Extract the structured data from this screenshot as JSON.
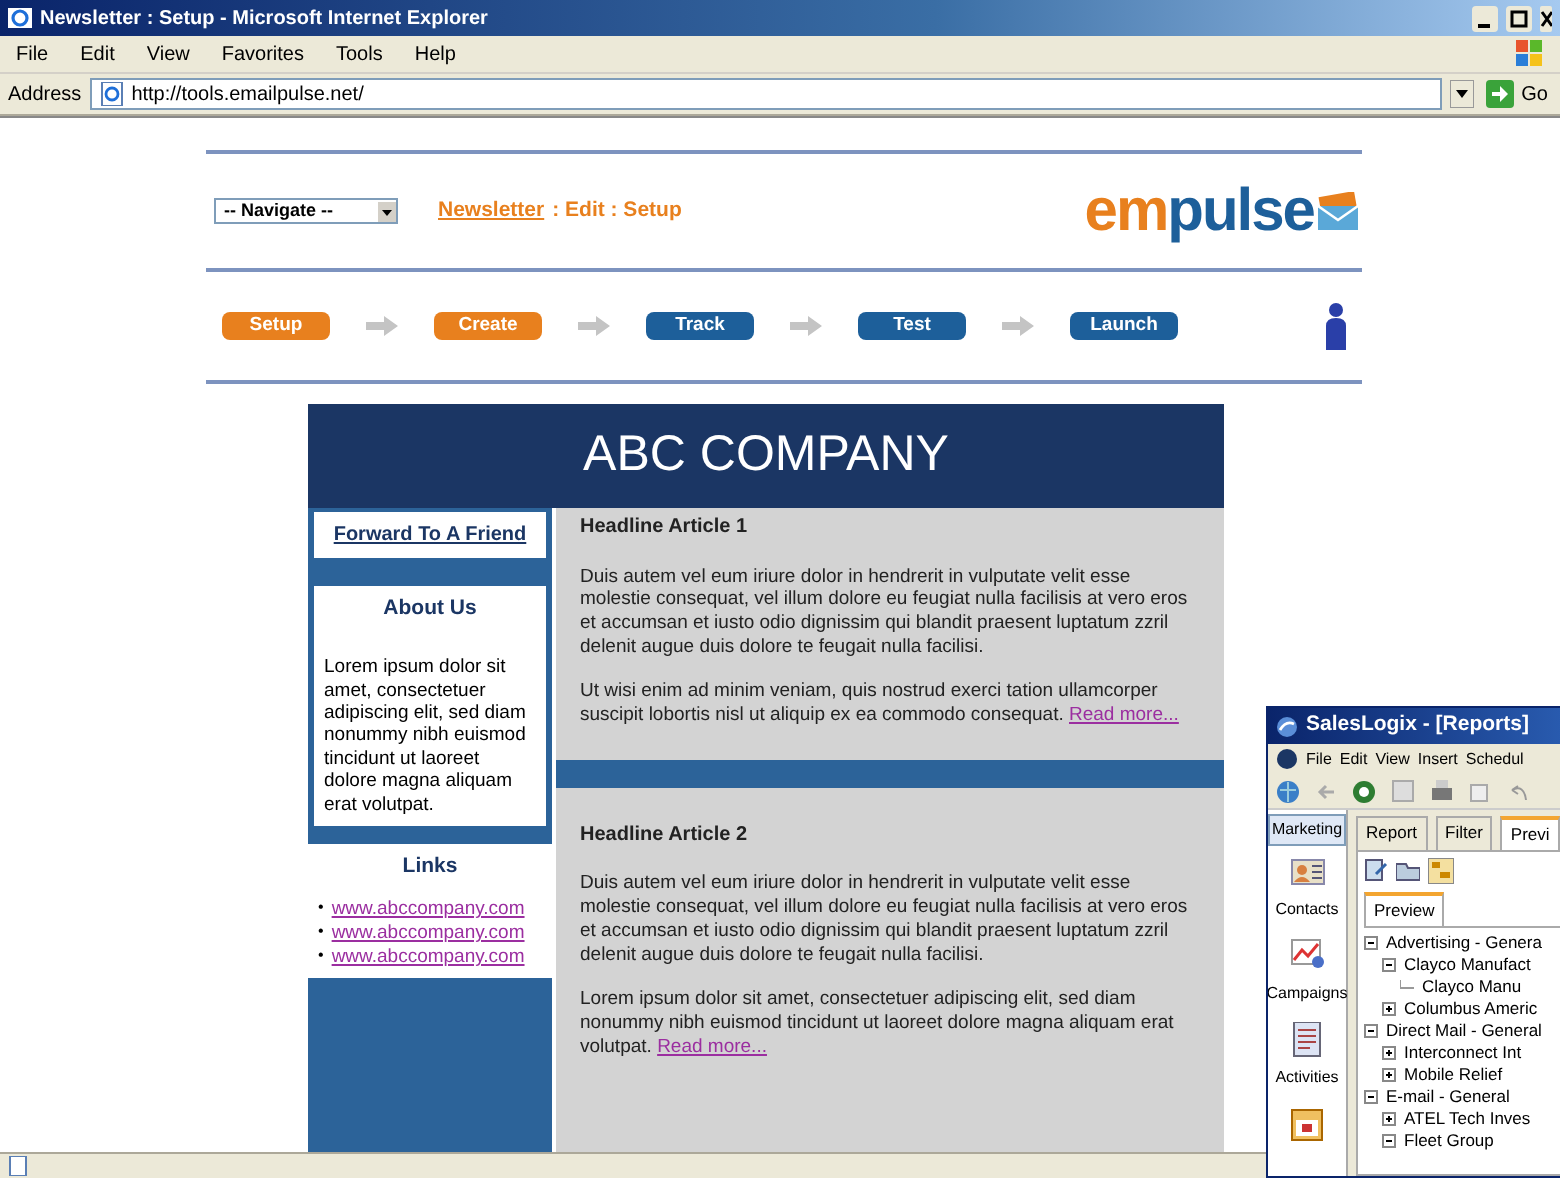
{
  "browser": {
    "title": "Newsletter : Setup - Microsoft Internet Explorer",
    "menu": [
      "File",
      "Edit",
      "View",
      "Favorites",
      "Tools",
      "Help"
    ],
    "address_label": "Address",
    "url": "http://tools.emailpulse.net/",
    "go": "Go"
  },
  "app": {
    "navigate": "-- Navigate --",
    "breadcrumb_link": "Newsletter",
    "breadcrumb_rest": ": Edit : Setup",
    "logo": [
      {
        "text": "em",
        "color": "#e8801e"
      },
      {
        "text": "pu",
        "color": "#1d5f9a"
      },
      {
        "text": "l",
        "color": "#1d5f9a"
      },
      {
        "text": "se",
        "color": "#1d5f9a"
      }
    ],
    "steps": [
      {
        "label": "Setup",
        "done": true
      },
      {
        "label": "Create",
        "done": true
      },
      {
        "label": "Track",
        "done": false
      },
      {
        "label": "Test",
        "done": false
      },
      {
        "label": "Launch",
        "done": false
      }
    ]
  },
  "newsletter": {
    "title": "ABC COMPANY",
    "forward": "Forward To A Friend",
    "about_title": "About Us",
    "about_text": "Lorem ipsum dolor sit amet, consectetuer adipiscing elit, sed diam nonummy nibh euismod tincidunt ut laoreet dolore magna aliquam erat volutpat.",
    "links_title": "Links",
    "bullet": "•",
    "links": [
      "www.abccompany.com",
      "www.abccompany.com",
      "www.abccompany.com"
    ],
    "articles": [
      {
        "headline": "Headline Article 1",
        "paragraphs": [
          "Duis autem vel eum iriure dolor in hendrerit in vulputate velit esse molestie consequat, vel illum dolore eu feugiat nulla facilisis at vero eros et accumsan et iusto odio dignissim qui blandit praesent luptatum zzril delenit augue duis dolore te feugait nulla facilisi.",
          "Ut wisi enim ad minim veniam, quis nostrud exerci tation ullamcorper suscipit lobortis nisl ut aliquip ex ea commodo consequat."
        ],
        "read_more": "Read more..."
      },
      {
        "headline": "Headline Article 2",
        "paragraphs": [
          "Duis autem vel eum iriure dolor in hendrerit in vulputate velit esse molestie consequat, vel illum dolore eu feugiat nulla facilisis at vero eros et accumsan et iusto odio dignissim qui blandit praesent luptatum zzril delenit augue duis dolore te feugait nulla facilisi.",
          "Lorem ipsum dolor sit amet, consectetuer adipiscing elit, sed diam nonummy nibh euismod tincidunt ut laoreet dolore magna aliquam erat volutpat."
        ],
        "read_more": "Read more..."
      }
    ]
  },
  "saleslogix": {
    "title": "SalesLogix - [Reports]",
    "menu": [
      "File",
      "Edit",
      "View",
      "Insert",
      "Schedul"
    ],
    "nav_header": "Marketing",
    "nav_items": [
      {
        "label": "Contacts",
        "kind": "contacts"
      },
      {
        "label": "Campaigns",
        "kind": "campaigns"
      },
      {
        "label": "Activities",
        "kind": "activities"
      },
      {
        "kind": "calendar"
      }
    ],
    "tabs": [
      {
        "label": "Report",
        "selected": false
      },
      {
        "label": "Filter",
        "selected": false
      },
      {
        "label": "Previ",
        "selected": true
      }
    ],
    "subtab": "Preview",
    "tree": [
      {
        "label": "Advertising - Genera",
        "expanded": true,
        "children": [
          {
            "label": "Clayco Manufact",
            "expanded": true,
            "children": [
              {
                "label": "Clayco Manu"
              }
            ]
          },
          {
            "label": "Columbus Americ",
            "expanded": false
          }
        ]
      },
      {
        "label": "Direct Mail - General",
        "expanded": true,
        "children": [
          {
            "label": "Interconnect Int",
            "expanded": false
          },
          {
            "label": "Mobile Relief",
            "expanded": false
          }
        ]
      },
      {
        "label": "E-mail - General",
        "expanded": true,
        "children": [
          {
            "label": "ATEL Tech Inves",
            "expanded": false
          },
          {
            "label": "Fleet Group",
            "expanded": true
          }
        ]
      }
    ]
  }
}
